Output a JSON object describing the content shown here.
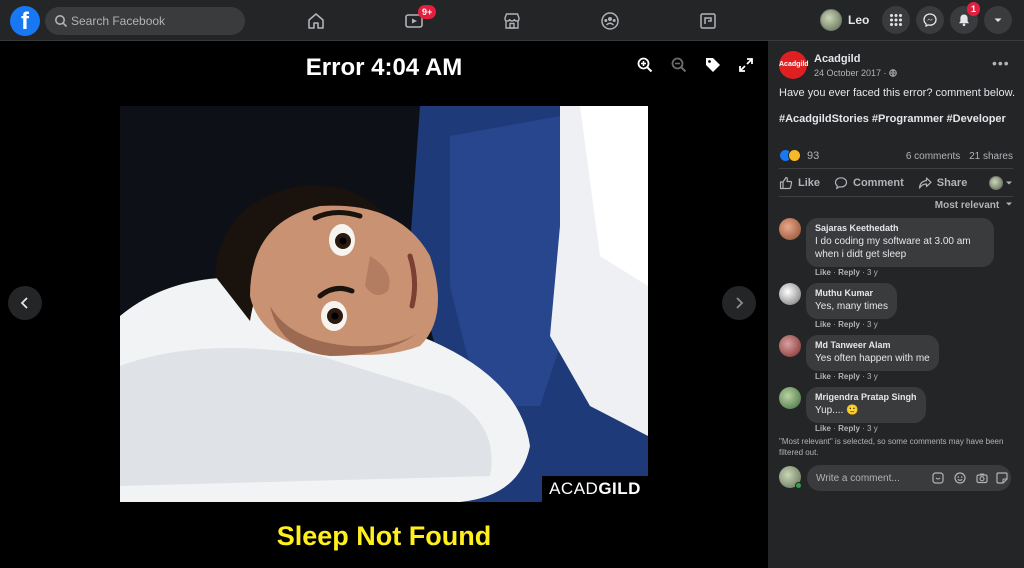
{
  "header": {
    "logo": "f",
    "search_placeholder": "Search Facebook",
    "watch_badge": "9+",
    "profile_name": "Leo",
    "notifications_badge": "1"
  },
  "viewer": {
    "title": "Error 4:04 AM",
    "watermark_light": "ACAD",
    "watermark_bold": "GILD",
    "caption": "Sleep Not Found"
  },
  "post": {
    "author": "Acadgild",
    "avatar_text": "Acadgild",
    "date": "24 October 2017 ·",
    "text": "Have you ever faced this error? comment below.",
    "hashtags": "#AcadgildStories #Programmer #Developer",
    "reaction_count": "93",
    "comments_count": "6 comments",
    "shares_count": "21 shares",
    "actions": {
      "like": "Like",
      "comment": "Comment",
      "share": "Share"
    },
    "sort_label": "Most relevant"
  },
  "comments": [
    {
      "name": "Sajaras Keethedath",
      "text": "I do coding my software at 3.00 am when i didt get sleep",
      "like": "Like",
      "reply": "Reply",
      "age": "3 y"
    },
    {
      "name": "Muthu Kumar",
      "text": "Yes, many times",
      "like": "Like",
      "reply": "Reply",
      "age": "3 y"
    },
    {
      "name": "Md Tanweer Alam",
      "text": "Yes often happen with me",
      "like": "Like",
      "reply": "Reply",
      "age": "3 y"
    },
    {
      "name": "Mrigendra Pratap Singh",
      "text": "Yup.... 🙂",
      "like": "Like",
      "reply": "Reply",
      "age": "3 y"
    }
  ],
  "filter_note": "\"Most relevant\" is selected, so some comments may have been filtered out.",
  "write_comment_placeholder": "Write a comment...",
  "colors": {
    "brand": "#1877f2",
    "caption_yellow": "#ffef1f",
    "badge_red": "#e41e3f",
    "panel_bg": "#242526"
  }
}
